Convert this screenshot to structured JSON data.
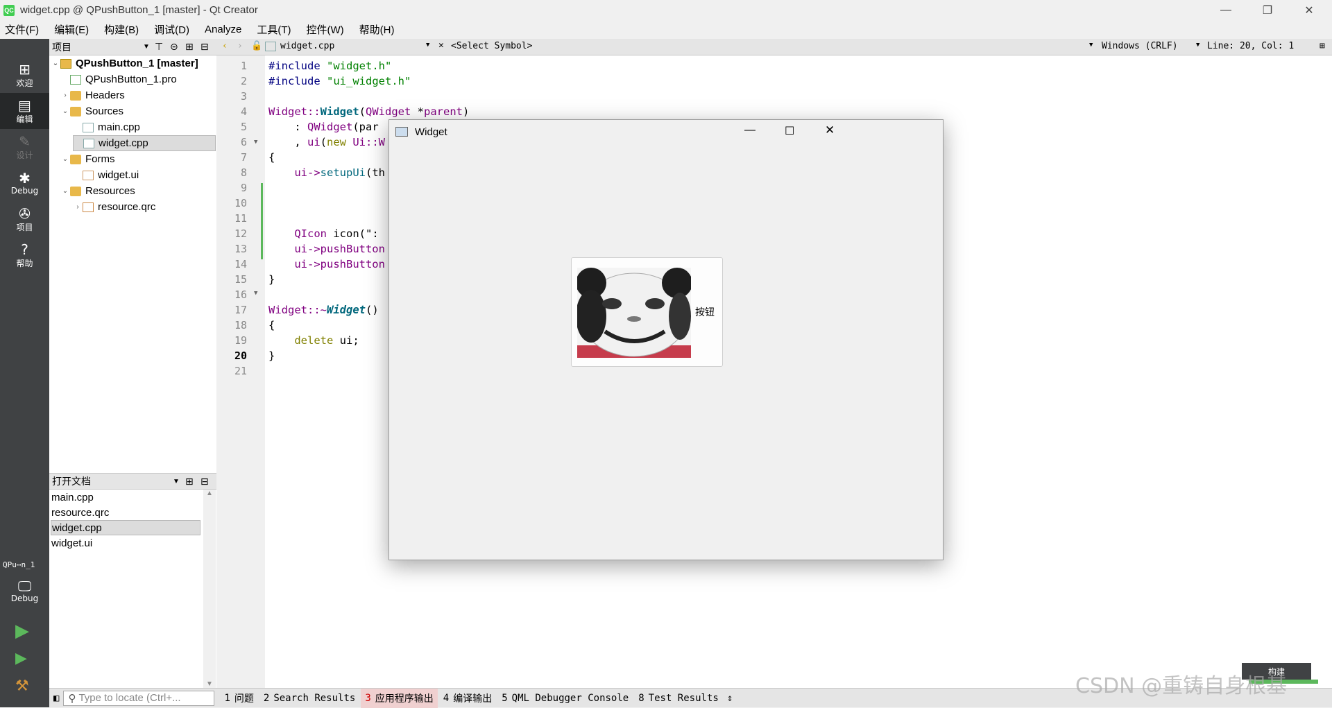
{
  "window": {
    "title": "widget.cpp @ QPushButton_1 [master] - Qt Creator",
    "app_icon": "QC"
  },
  "menu": [
    "文件(F)",
    "编辑(E)",
    "构建(B)",
    "调试(D)",
    "Analyze",
    "工具(T)",
    "控件(W)",
    "帮助(H)"
  ],
  "modes": [
    {
      "label": "欢迎",
      "icon": "⊞"
    },
    {
      "label": "编辑",
      "icon": "▤"
    },
    {
      "label": "设计",
      "icon": "✎"
    },
    {
      "label": "Debug",
      "icon": "✱"
    },
    {
      "label": "项目",
      "icon": "✇"
    },
    {
      "label": "帮助",
      "icon": "?"
    }
  ],
  "kit": {
    "project_short": "QPu⋯n_1",
    "config": "Debug"
  },
  "projects_panel": {
    "title": "项目"
  },
  "tree": [
    {
      "label": "QPushButton_1 [master]",
      "type": "proj"
    },
    {
      "label": "QPushButton_1.pro",
      "type": "pro"
    },
    {
      "label": "Headers",
      "type": "folder"
    },
    {
      "label": "Sources",
      "type": "folder"
    },
    {
      "label": "main.cpp",
      "type": "cpp"
    },
    {
      "label": "widget.cpp",
      "type": "cpp"
    },
    {
      "label": "Forms",
      "type": "folder"
    },
    {
      "label": "widget.ui",
      "type": "ui"
    },
    {
      "label": "Resources",
      "type": "folder"
    },
    {
      "label": "resource.qrc",
      "type": "qrc"
    }
  ],
  "open_docs": {
    "title": "打开文档",
    "items": [
      "main.cpp",
      "resource.qrc",
      "widget.cpp",
      "widget.ui"
    ],
    "selected": 2
  },
  "editor": {
    "file": "widget.cpp",
    "symbol": "<Select Symbol>",
    "line_ending": "Windows (CRLF)",
    "position": "Line: 20, Col: 1",
    "line_numbers": [
      "1",
      "2",
      "3",
      "4",
      "5",
      "6",
      "7",
      "8",
      "9",
      "10",
      "11",
      "12",
      "13",
      "14",
      "15",
      "16",
      "17",
      "18",
      "19",
      "20",
      "21"
    ]
  },
  "code": {
    "l1a": "#include ",
    "l1b": "\"widget.h\"",
    "l2a": "#include ",
    "l2b": "\"ui_widget.h\"",
    "l4a": "Widget::",
    "l4b": "Widget",
    "l4c": "(",
    "l4d": "QWidget",
    "l4e": " *",
    "l4f": "parent",
    "l4g": ")",
    "l5a": "    : ",
    "l5b": "QWidget",
    "l5c": "(par",
    "l6a": "    , ",
    "l6b": "ui",
    "l6c": "(",
    "l6d": "new",
    "l6e": " Ui::W",
    "l7": "{",
    "l8a": "    ui->",
    "l8b": "setupUi",
    "l8c": "(th",
    "l11a": "    QIcon ",
    "l11b": "icon(\":",
    "l12a": "    ui->",
    "l12b": "pushButton",
    "l13a": "    ui->",
    "l13b": "pushButton",
    "l14": "}",
    "l16a": "Widget::~",
    "l16b": "Widget",
    "l16c": "()",
    "l17": "{",
    "l18a": "    ",
    "l18b": "delete",
    "l18c": " ui;",
    "l19": "}"
  },
  "widget_window": {
    "title": "Widget",
    "button_label": "按钮"
  },
  "output_tabs": [
    {
      "num": "1",
      "label": "问题"
    },
    {
      "num": "2",
      "label": "Search Results"
    },
    {
      "num": "3",
      "label": "应用程序输出"
    },
    {
      "num": "4",
      "label": "编译输出"
    },
    {
      "num": "5",
      "label": "QML Debugger Console"
    },
    {
      "num": "8",
      "label": "Test Results"
    }
  ],
  "locator": {
    "placeholder": "Type to locate (Ctrl+..."
  },
  "build_tooltip": "构建",
  "watermark": "CSDN @重铸自身根基"
}
